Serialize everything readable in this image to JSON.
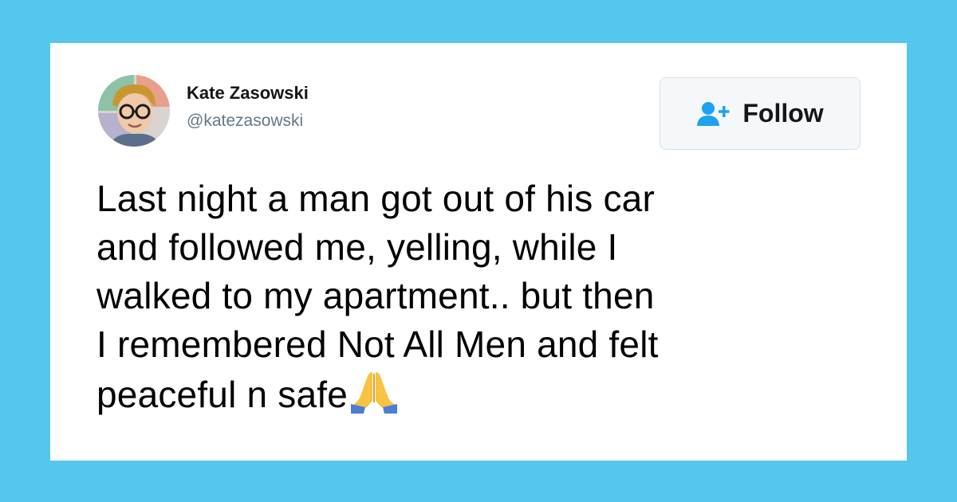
{
  "tweet": {
    "user": {
      "display_name": "Kate Zasowski",
      "handle": "@katezasowski"
    },
    "follow_label": "Follow",
    "text_lines": [
      "Last night a man got out of his car",
      "and followed me, yelling, while I",
      "walked to my apartment.. but then",
      "I remembered Not All Men and felt",
      "peaceful n safe"
    ],
    "emoji": "folded-hands-emoji"
  },
  "colors": {
    "background": "#55c7ec",
    "card": "#ffffff",
    "follow_icon": "#1da1f2",
    "handle": "#657786"
  }
}
